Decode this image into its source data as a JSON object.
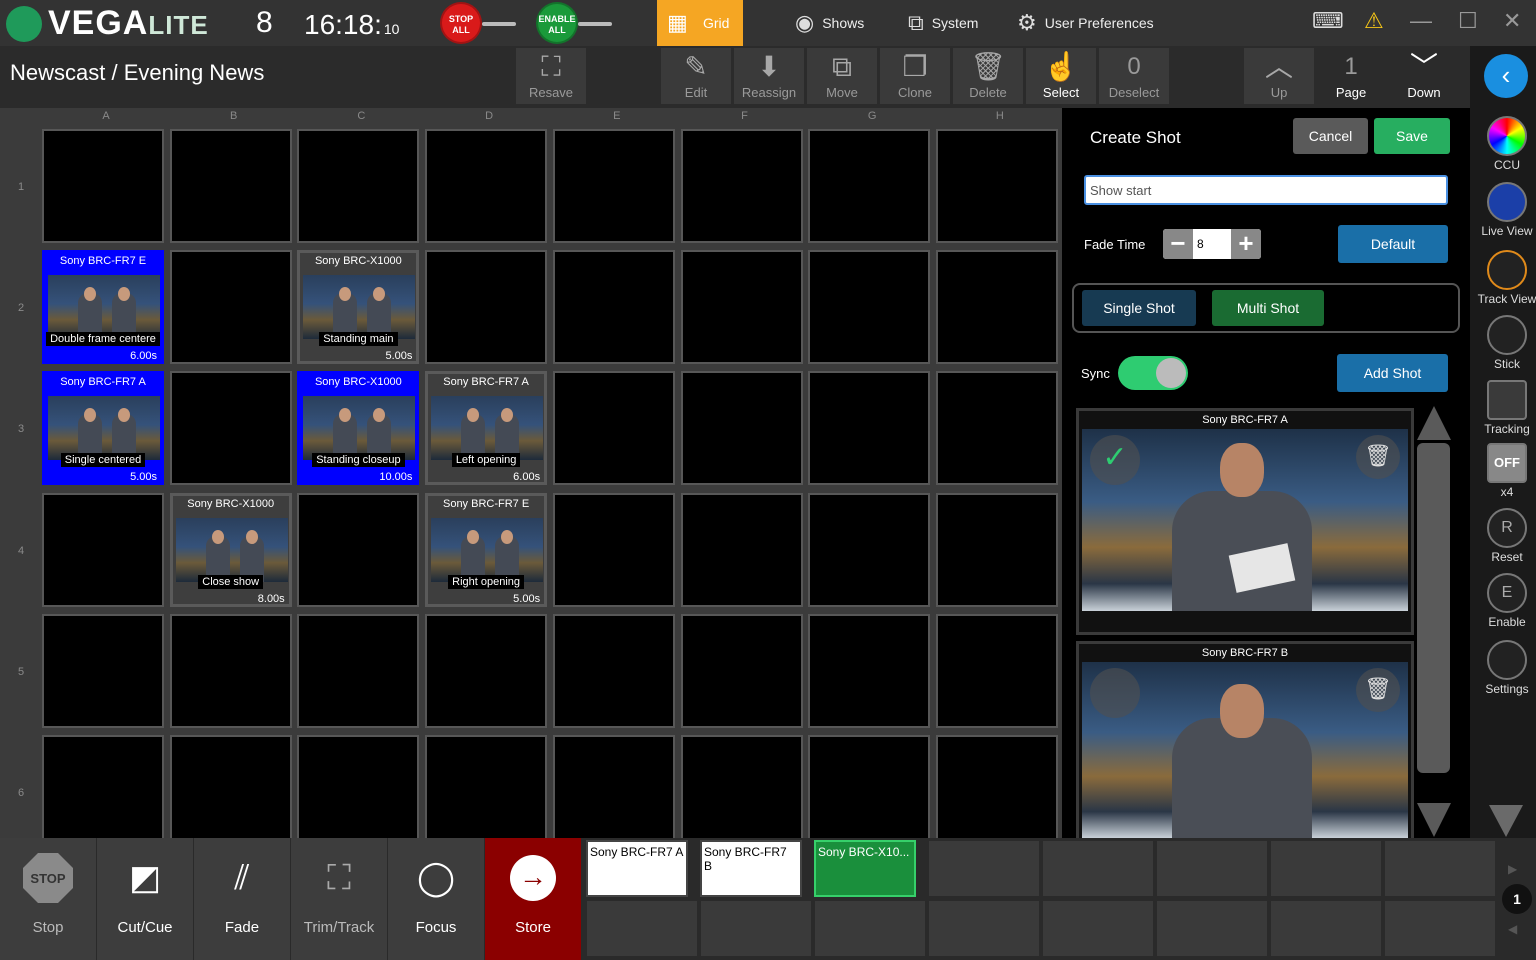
{
  "app": {
    "logo_main": "VEGA",
    "logo_sub": "LITE",
    "version": "8",
    "clock_main": "16:18:",
    "clock_sec": "10"
  },
  "topbar": {
    "stop_all": "STOP ALL",
    "enable_all": "ENABLE ALL",
    "grid_tab": "Grid",
    "shows": "Shows",
    "system": "System",
    "user_prefs": "User Preferences",
    "icons": {
      "keyboard": "keyboard-icon",
      "warning": "warning-icon",
      "minimize": "minimize-icon",
      "maximize": "maximize-icon",
      "close": "close-icon"
    }
  },
  "breadcrumb": "Newscast / Evening News",
  "toolbar": {
    "resave": "Resave",
    "edit": "Edit",
    "reassign": "Reassign",
    "move": "Move",
    "clone": "Clone",
    "delete": "Delete",
    "select": "Select",
    "deselect_count": "0",
    "deselect": "Deselect",
    "up": "Up",
    "page_num": "1",
    "page": "Page",
    "down": "Down"
  },
  "grid": {
    "columns": [
      "A",
      "B",
      "C",
      "D",
      "E",
      "F",
      "G",
      "H"
    ],
    "rows": [
      "1",
      "2",
      "3",
      "4",
      "5",
      "6"
    ],
    "shots": [
      {
        "col": 0,
        "row": 1,
        "camera": "Sony BRC-FR7 E",
        "name": "Double frame centere",
        "duration": "6.00s",
        "selected": true
      },
      {
        "col": 2,
        "row": 1,
        "camera": "Sony BRC-X1000",
        "name": "Standing main",
        "duration": "5.00s",
        "selected": false
      },
      {
        "col": 0,
        "row": 2,
        "camera": "Sony BRC-FR7 A",
        "name": "Single centered",
        "duration": "5.00s",
        "selected": true
      },
      {
        "col": 2,
        "row": 2,
        "camera": "Sony BRC-X1000",
        "name": "Standing closeup",
        "duration": "10.00s",
        "selected": true
      },
      {
        "col": 3,
        "row": 2,
        "camera": "Sony BRC-FR7 A",
        "name": "Left opening",
        "duration": "6.00s",
        "selected": false
      },
      {
        "col": 1,
        "row": 3,
        "camera": "Sony BRC-X1000",
        "name": "Close show",
        "duration": "8.00s",
        "selected": false
      },
      {
        "col": 3,
        "row": 3,
        "camera": "Sony BRC-FR7 E",
        "name": "Right opening",
        "duration": "5.00s",
        "selected": false
      }
    ]
  },
  "panel": {
    "title": "Create Shot",
    "cancel": "Cancel",
    "save": "Save",
    "name_value": "Show start",
    "fade_label": "Fade Time",
    "fade_value": "8",
    "default": "Default",
    "single_shot": "Single Shot",
    "multi_shot": "Multi Shot",
    "sync_label": "Sync",
    "sync_on": true,
    "add_shot": "Add Shot",
    "shot_cards": [
      {
        "camera": "Sony BRC-FR7 A",
        "checked": true
      },
      {
        "camera": "Sony BRC-FR7 B",
        "checked": false
      }
    ]
  },
  "rail": {
    "items": [
      {
        "label": "CCU",
        "icon": "color-wheel-icon"
      },
      {
        "label": "Live View",
        "icon": "monitor-icon"
      },
      {
        "label": "Track View",
        "icon": "tracking-person-icon"
      },
      {
        "label": "Stick",
        "icon": "joystick-icon"
      },
      {
        "label": "Tracking",
        "icon": "tracking-box-icon"
      },
      {
        "label": "x4",
        "icon": "off-toggle-icon",
        "badge": "OFF"
      },
      {
        "label": "Reset",
        "icon": "reset-icon",
        "badge": "R"
      },
      {
        "label": "Enable",
        "icon": "enable-icon",
        "badge": "E"
      },
      {
        "label": "Settings",
        "icon": "camera-settings-icon"
      }
    ]
  },
  "bottombar": {
    "stop_badge": "STOP",
    "stop": "Stop",
    "cutcue": "Cut/Cue",
    "fade": "Fade",
    "trimtrack": "Trim/Track",
    "focus": "Focus",
    "store": "Store",
    "slots": [
      "Sony BRC-FR7 A",
      "Sony BRC-FR7 B",
      "Sony BRC-X10..."
    ],
    "page_badge": "1"
  },
  "colors": {
    "accent_green": "#2ecc71",
    "grid_tab": "#f5a623",
    "store_red": "#8b0000",
    "select_blue": "#0000ff",
    "button_blue": "#1a6fa8"
  }
}
